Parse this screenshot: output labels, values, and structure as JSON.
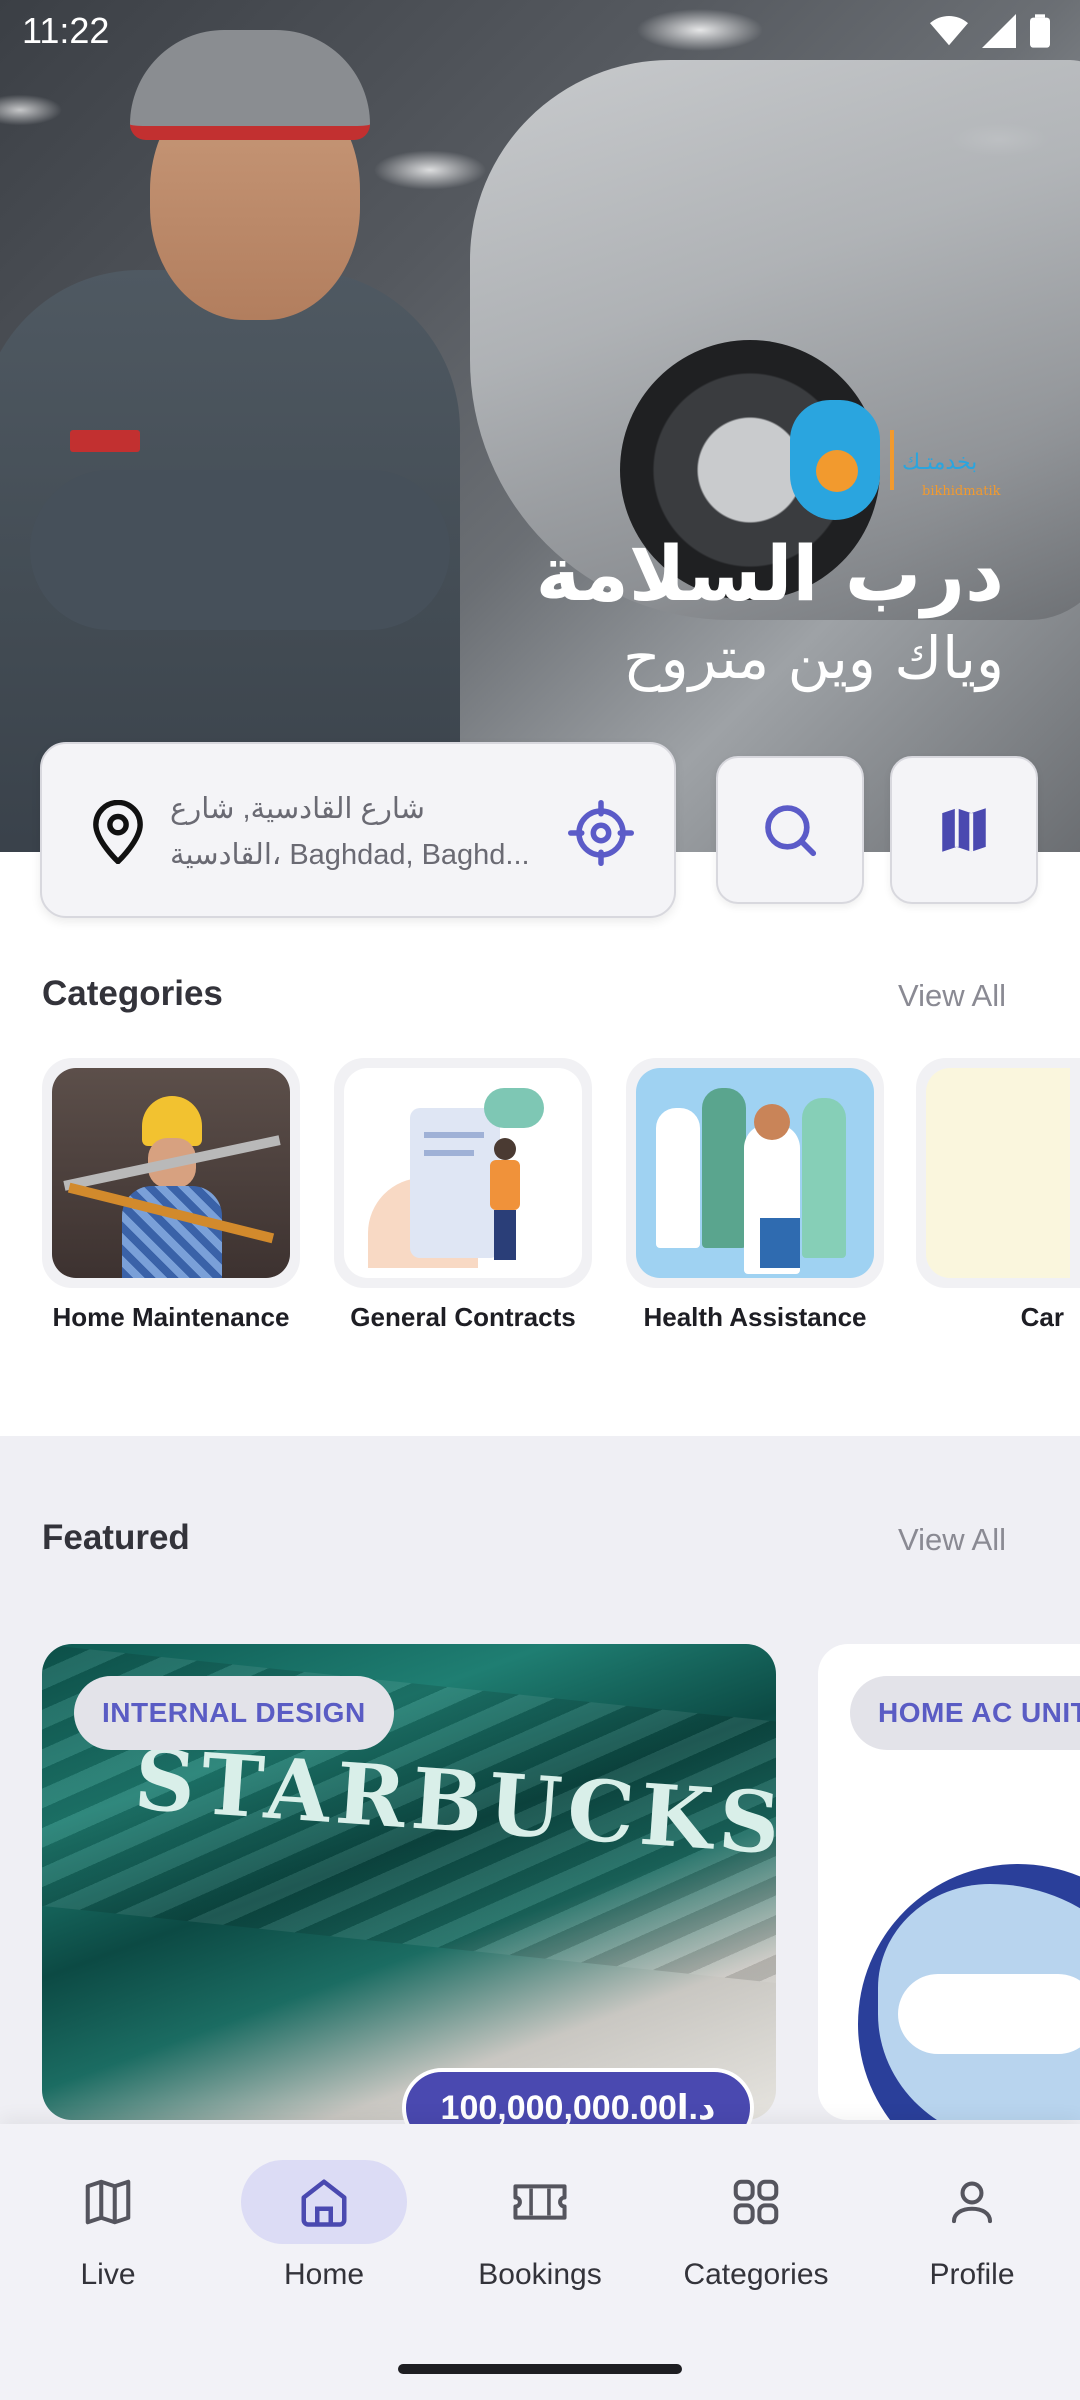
{
  "status_bar": {
    "time": "11:22"
  },
  "hero": {
    "headline_line1": "درب السلامة",
    "headline_line2": "وياك وين متروح",
    "logo_text_ar": "بخدمتـك",
    "logo_text_en": "bikhidmatik"
  },
  "location": {
    "line1": "شارع القادسية, شارع",
    "line2": "القادسية، Baghdad, Baghd..."
  },
  "categories": {
    "title": "Categories",
    "view_all": "View All",
    "items": [
      {
        "label": "Home Maintenance"
      },
      {
        "label": "General Contracts"
      },
      {
        "label": "Health Assistance"
      },
      {
        "label": "Car"
      }
    ]
  },
  "featured": {
    "title": "Featured",
    "view_all": "View All",
    "items": [
      {
        "tag": "INTERNAL DESIGN",
        "image_text": "STARBUCKS",
        "price": "100,000,000.00د.ا"
      },
      {
        "tag": "HOME AC UNIT"
      }
    ]
  },
  "bottom_nav": {
    "items": [
      {
        "label": "Live",
        "icon": "map-icon"
      },
      {
        "label": "Home",
        "icon": "home-icon",
        "active": true
      },
      {
        "label": "Bookings",
        "icon": "ticket-icon"
      },
      {
        "label": "Categories",
        "icon": "grid-icon"
      },
      {
        "label": "Profile",
        "icon": "user-icon"
      }
    ]
  },
  "colors": {
    "accent": "#4a49b0",
    "accent_light": "#dcdcf5",
    "pill_text": "#5a5cc4"
  }
}
